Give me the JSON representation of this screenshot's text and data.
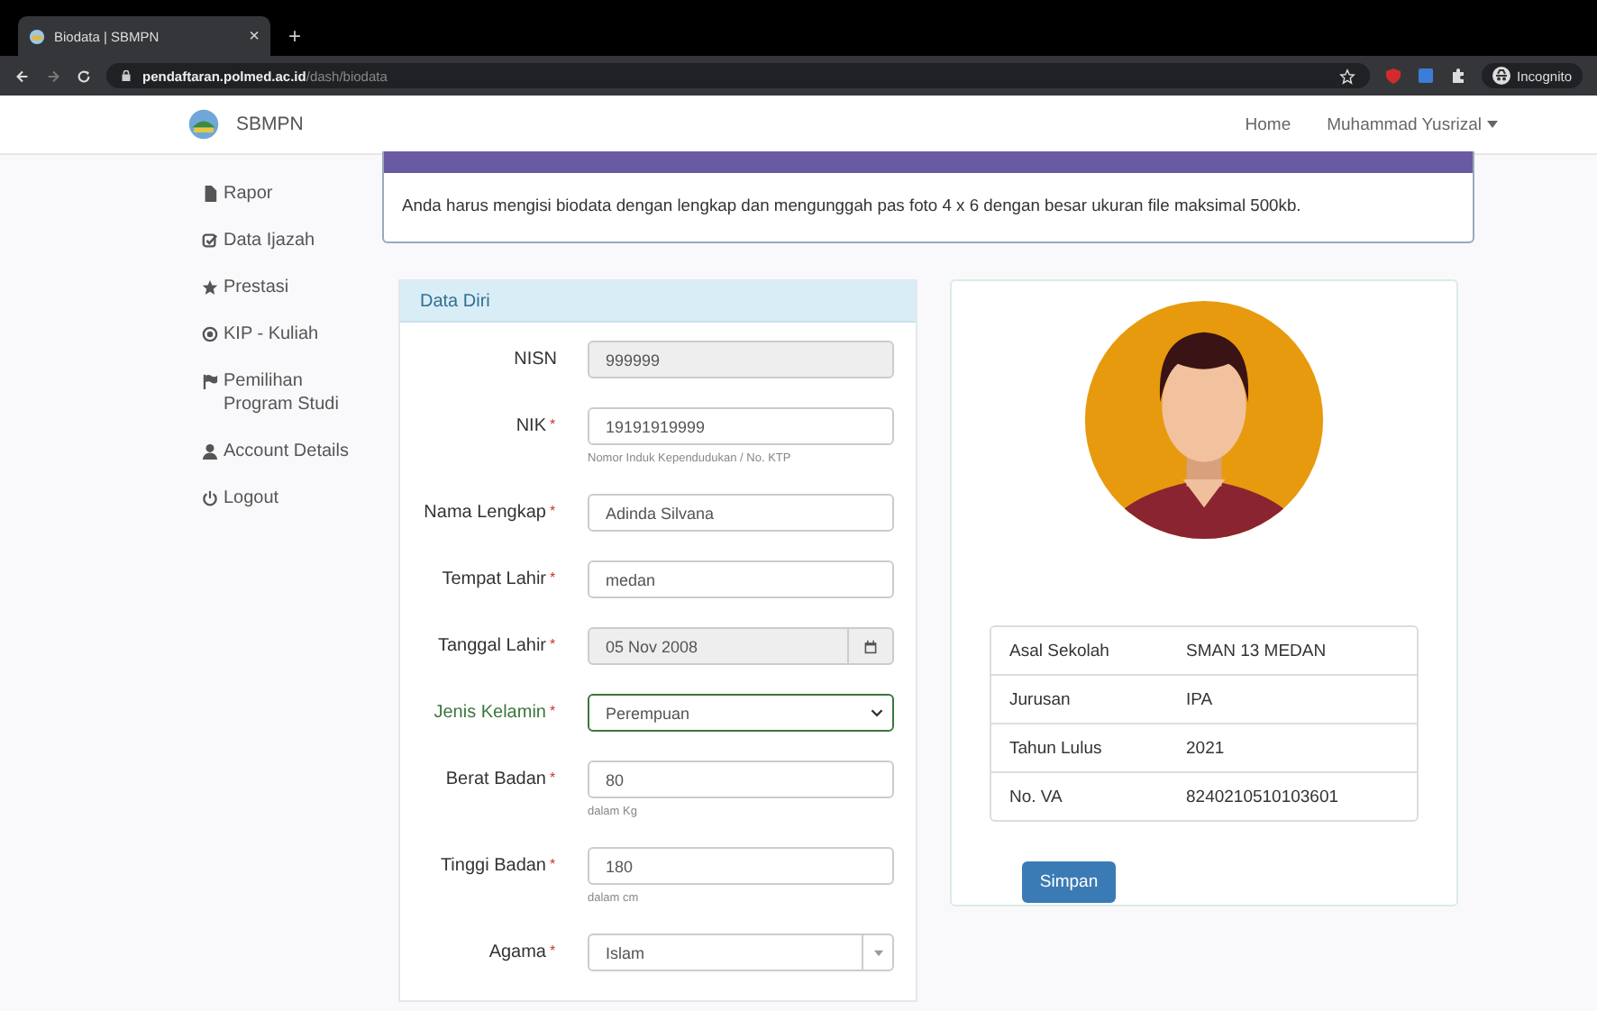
{
  "browser": {
    "tab_title": "Biodata | SBMPN",
    "tab_close": "×",
    "new_tab": "+",
    "url_host": "pendaftaran.polmed.ac.id",
    "url_path": "/dash/biodata",
    "incognito": "Incognito"
  },
  "navbar": {
    "brand": "SBMPN",
    "links": [
      "Home",
      "Muhammad Yusrizal"
    ]
  },
  "sidebar": {
    "items": [
      {
        "label": "Rapor"
      },
      {
        "label": "Data Ijazah"
      },
      {
        "label": "Prestasi"
      },
      {
        "label": "KIP - Kuliah"
      },
      {
        "label": "Pemilihan Program Studi"
      },
      {
        "label": "Account Details"
      },
      {
        "label": "Logout"
      }
    ]
  },
  "info": {
    "message": "Anda harus mengisi biodata dengan lengkap dan mengunggah pas foto 4 x 6 dengan besar ukuran file maksimal 500kb."
  },
  "form": {
    "title": "Data Diri",
    "required_mark": "*",
    "fields": [
      {
        "label": "NISN",
        "required": false,
        "kind": "text",
        "value": "999999",
        "disabled": true,
        "valid": false
      },
      {
        "label": "NIK",
        "required": true,
        "kind": "text",
        "value": "19191919999",
        "disabled": false,
        "valid": false,
        "help": "Nomor Induk Kependudukan / No. KTP"
      },
      {
        "label": "Nama Lengkap",
        "required": true,
        "kind": "text",
        "value": "Adinda Silvana",
        "disabled": false,
        "valid": false
      },
      {
        "label": "Tempat Lahir",
        "required": true,
        "kind": "text",
        "value": "medan",
        "disabled": false,
        "valid": false
      },
      {
        "label": "Tanggal Lahir",
        "required": true,
        "kind": "date",
        "value": "05 Nov 2008",
        "disabled": true,
        "valid": false
      },
      {
        "label": "Jenis Kelamin",
        "required": true,
        "kind": "select",
        "value": "Perempuan",
        "disabled": false,
        "valid": true
      },
      {
        "label": "Berat Badan",
        "required": true,
        "kind": "text",
        "value": "80",
        "disabled": false,
        "valid": false,
        "help": "dalam Kg"
      },
      {
        "label": "Tinggi Badan",
        "required": true,
        "kind": "text",
        "value": "180",
        "disabled": false,
        "valid": false,
        "help": "dalam cm"
      },
      {
        "label": "Agama",
        "required": true,
        "kind": "combo",
        "value": "Islam",
        "disabled": false,
        "valid": false
      }
    ]
  },
  "profile": {
    "details": [
      {
        "label": "Asal Sekolah",
        "value": "SMAN 13 MEDAN"
      },
      {
        "label": "Jurusan",
        "value": "IPA"
      },
      {
        "label": "Tahun Lulus",
        "value": "2021"
      },
      {
        "label": "No. VA",
        "value": "8240210510103601"
      }
    ],
    "save_button": "Simpan"
  }
}
